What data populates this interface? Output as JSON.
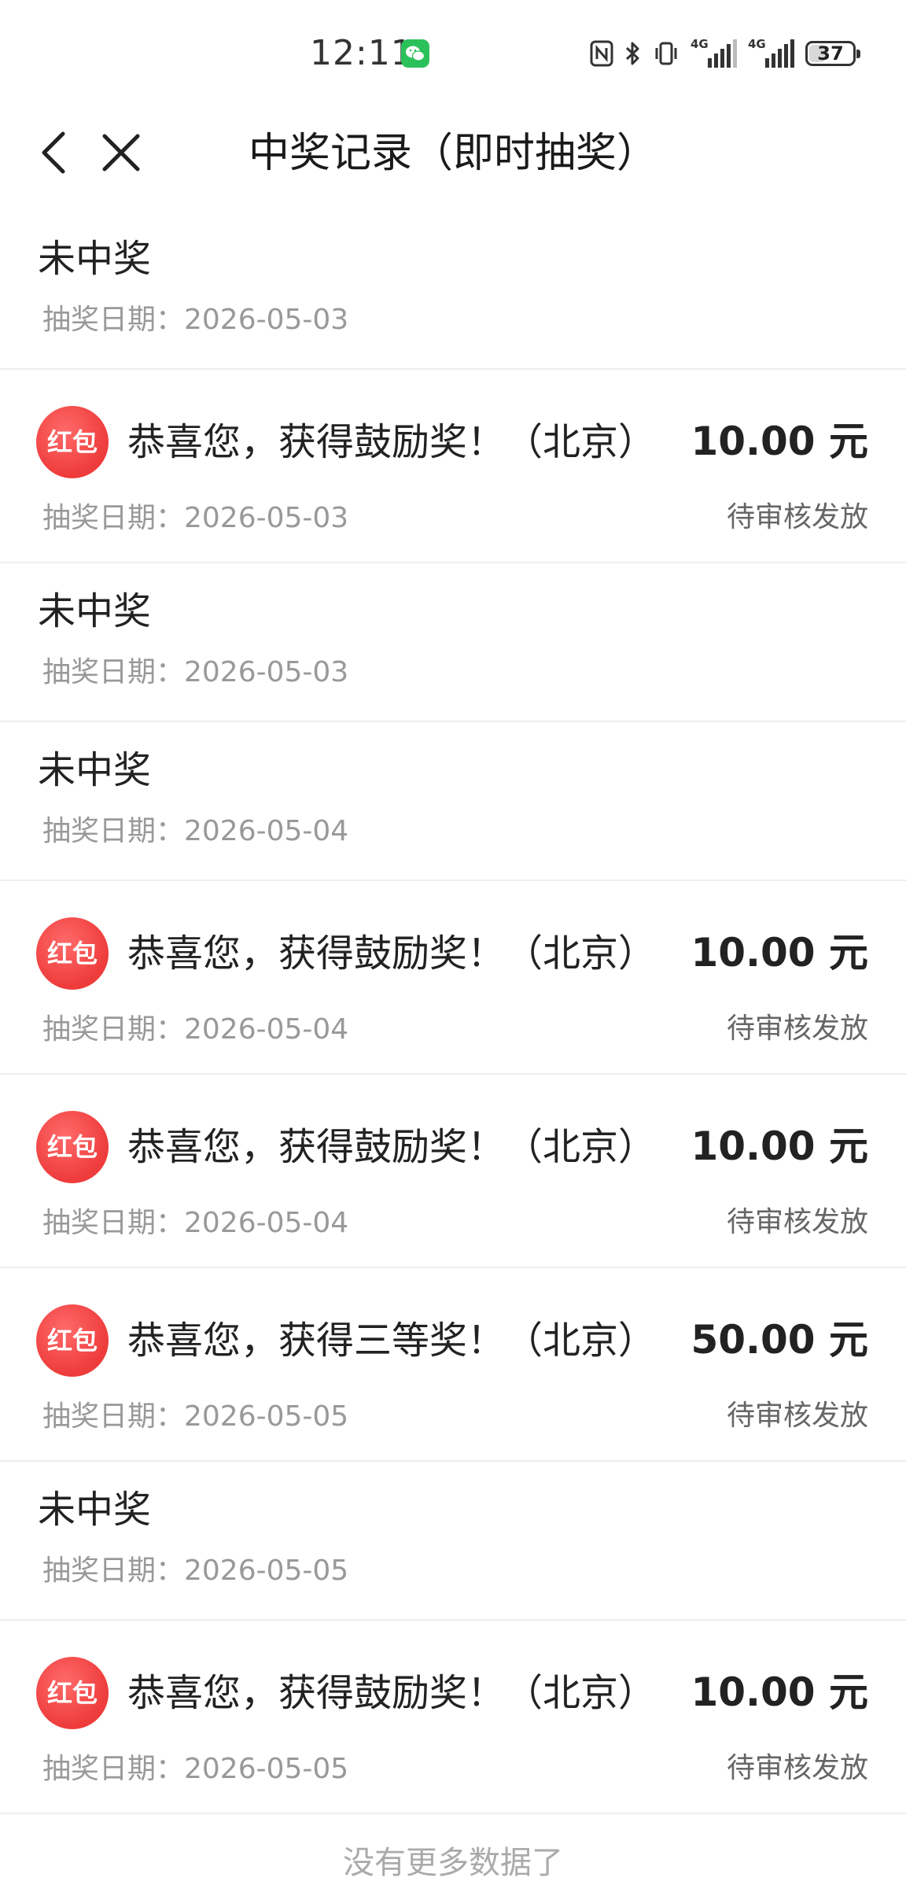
{
  "status_bar": {
    "time": "12:11",
    "network_1": "4G",
    "network_2": "4G",
    "battery": "37",
    "battery_level": 0.37
  },
  "header": {
    "title": "中奖记录（即时抽奖）"
  },
  "records": [
    {
      "type": "lose",
      "title": "未中奖",
      "date": "抽奖日期：2026-05-03"
    },
    {
      "type": "win",
      "badge": "红包",
      "title": "恭喜您，获得鼓励奖！（北京）",
      "amount": "10.00 元",
      "date": "抽奖日期：2026-05-03",
      "status": "待审核发放"
    },
    {
      "type": "lose",
      "title": "未中奖",
      "date": "抽奖日期：2026-05-03"
    },
    {
      "type": "lose",
      "title": "未中奖",
      "date": "抽奖日期：2026-05-04"
    },
    {
      "type": "win",
      "badge": "红包",
      "title": "恭喜您，获得鼓励奖！（北京）",
      "amount": "10.00 元",
      "date": "抽奖日期：2026-05-04",
      "status": "待审核发放"
    },
    {
      "type": "win",
      "badge": "红包",
      "title": "恭喜您，获得鼓励奖！（北京）",
      "amount": "10.00 元",
      "date": "抽奖日期：2026-05-04",
      "status": "待审核发放"
    },
    {
      "type": "win",
      "badge": "红包",
      "title": "恭喜您，获得三等奖！（北京）",
      "amount": "50.00 元",
      "date": "抽奖日期：2026-05-05",
      "status": "待审核发放"
    },
    {
      "type": "lose",
      "title": "未中奖",
      "date": "抽奖日期：2026-05-05"
    },
    {
      "type": "win",
      "badge": "红包",
      "title": "恭喜您，获得鼓励奖！（北京）",
      "amount": "10.00 元",
      "date": "抽奖日期：2026-05-05",
      "status": "待审核发放"
    }
  ],
  "footer": {
    "note": "没有更多数据了"
  },
  "colors": {
    "badge_red": "#ee3b3b",
    "wechat_green": "#2bc15a",
    "divider": "#eeeeee",
    "muted_text": "#999999"
  },
  "icons": {
    "back": "chevron-left-icon",
    "close": "close-icon",
    "status": [
      "wechat-icon",
      "nfc-icon",
      "bluetooth-icon",
      "vibrate-icon",
      "signal-icon",
      "battery-icon"
    ]
  }
}
